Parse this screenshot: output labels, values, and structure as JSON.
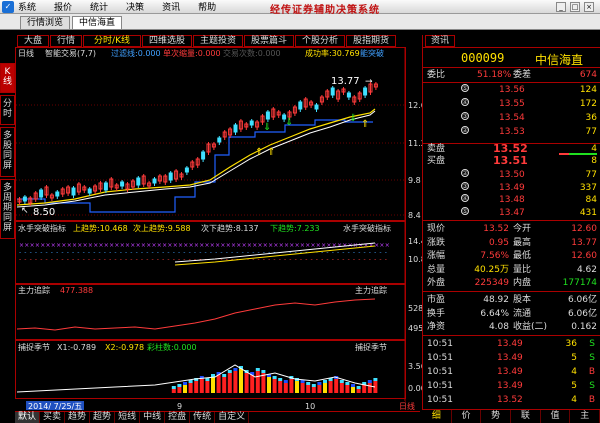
{
  "menu": {
    "items": [
      "系统",
      "报价",
      "统计",
      "决策",
      "资讯",
      "帮助"
    ],
    "title": "经传证券辅助决策系统"
  },
  "tabs": [
    {
      "label": "行情浏览",
      "active": false
    },
    {
      "label": "中信海直",
      "active": true
    }
  ],
  "funcbar": [
    {
      "label": "大盘",
      "active": false
    },
    {
      "label": "行情",
      "active": false
    },
    {
      "label": "分时/K线",
      "active": true
    },
    {
      "label": "四维选股",
      "active": false
    },
    {
      "label": "主题投资",
      "active": false
    },
    {
      "label": "股票篇斗",
      "active": false
    },
    {
      "label": "个股分析",
      "active": false
    },
    {
      "label": "股指期货",
      "active": false
    }
  ],
  "sidetabs": [
    "K线",
    "分时",
    "多股同屏",
    "多周期同屏"
  ],
  "main_panel": {
    "period": "日线",
    "indicator": "智能交易(7,7)",
    "line1": "过滤线:0.000",
    "line2": "单次缩量:0.000",
    "line3": "交易次数:0.000",
    "success": "成功率:30.769",
    "label2": "能突破",
    "high_label": "13.77",
    "low_label": "8.50",
    "ticks": [
      "12.6",
      "11.2",
      "9.8",
      "8.4"
    ]
  },
  "panel2": {
    "name": "水手突破指标",
    "up": "上趋势:10.468",
    "second": "次上趋势:9.588",
    "down2": "次下趋势:8.137",
    "down": "下趋势:7.233",
    "right": "水手突破指标",
    "ticks": [
      "14.43",
      "10.82"
    ]
  },
  "panel3": {
    "name": "主力追踪",
    "val": "477.388",
    "right": "主力追踪",
    "ticks": [
      "528.65",
      "495.61"
    ]
  },
  "panel4": {
    "name": "捕捉季节",
    "x1": "X1:-0.789",
    "x2": "X2:-0.978",
    "x3": "彩柱数:0.000",
    "right": "捕捉季节",
    "ticks": [
      "3.56",
      "0.00"
    ]
  },
  "xaxis": {
    "date": "2014/ 7/25/五",
    "m9": "9",
    "m10": "10",
    "brand": "日线"
  },
  "bottomtabs": [
    "默认",
    "买卖",
    "趋势",
    "超势",
    "短线",
    "中线",
    "控盘",
    "传统",
    "自定义"
  ],
  "quote": {
    "tab": "资讯",
    "code": "000099",
    "name": "中信海直",
    "weibi_label": "委比",
    "weibi_val": "51.18%",
    "weicha_label": "委差",
    "weicha_val": "674",
    "sell": [
      {
        "n": "⑤",
        "price": "13.56",
        "vol": "124"
      },
      {
        "n": "④",
        "price": "13.55",
        "vol": "172"
      },
      {
        "n": "③",
        "price": "13.54",
        "vol": "36"
      },
      {
        "n": "②",
        "price": "13.53",
        "vol": "77"
      },
      {
        "n": "①",
        "price": "13.52",
        "vol": "4"
      }
    ],
    "sell_label": "卖盘",
    "buy_label": "买盘",
    "buy": [
      {
        "n": "①",
        "price": "13.51",
        "vol": "8"
      },
      {
        "n": "②",
        "price": "13.50",
        "vol": "77"
      },
      {
        "n": "③",
        "price": "13.49",
        "vol": "337"
      },
      {
        "n": "④",
        "price": "13.48",
        "vol": "84"
      },
      {
        "n": "⑤",
        "price": "13.47",
        "vol": "431"
      }
    ],
    "stats": [
      {
        "l1": "现价",
        "v1": "13.52",
        "c1": "red",
        "l2": "今开",
        "v2": "12.60",
        "c2": "red"
      },
      {
        "l1": "涨跌",
        "v1": "0.95",
        "c1": "red",
        "l2": "最高",
        "v2": "13.77",
        "c2": "red"
      },
      {
        "l1": "涨幅",
        "v1": "7.56%",
        "c1": "red",
        "l2": "最低",
        "v2": "12.60",
        "c2": "red"
      },
      {
        "l1": "总量",
        "v1": "40.25万",
        "c1": "yel",
        "l2": "量比",
        "v2": "4.62",
        "c2": "wh"
      },
      {
        "l1": "外盘",
        "v1": "225349",
        "c1": "red",
        "l2": "内盘",
        "v2": "177174",
        "c2": "green"
      }
    ],
    "stats2": [
      {
        "l1": "市盈",
        "v1": "48.92",
        "l2": "股本",
        "v2": "6.06亿"
      },
      {
        "l1": "换手",
        "v1": "6.64%",
        "l2": "流通",
        "v2": "6.06亿"
      },
      {
        "l1": "净资",
        "v1": "4.08",
        "l2": "收益(二)",
        "v2": "0.162"
      }
    ],
    "ticks": [
      {
        "t": "10:51",
        "p": "13.49",
        "v": "36",
        "f": "S"
      },
      {
        "t": "10:51",
        "p": "13.49",
        "v": "5",
        "f": "S"
      },
      {
        "t": "10:51",
        "p": "13.49",
        "v": "4",
        "f": "B"
      },
      {
        "t": "10:51",
        "p": "13.49",
        "v": "5",
        "f": "S"
      },
      {
        "t": "10:51",
        "p": "13.52",
        "v": "4",
        "f": "B"
      }
    ],
    "btabs": [
      "细",
      "价",
      "势",
      "联",
      "值",
      "主"
    ]
  }
}
